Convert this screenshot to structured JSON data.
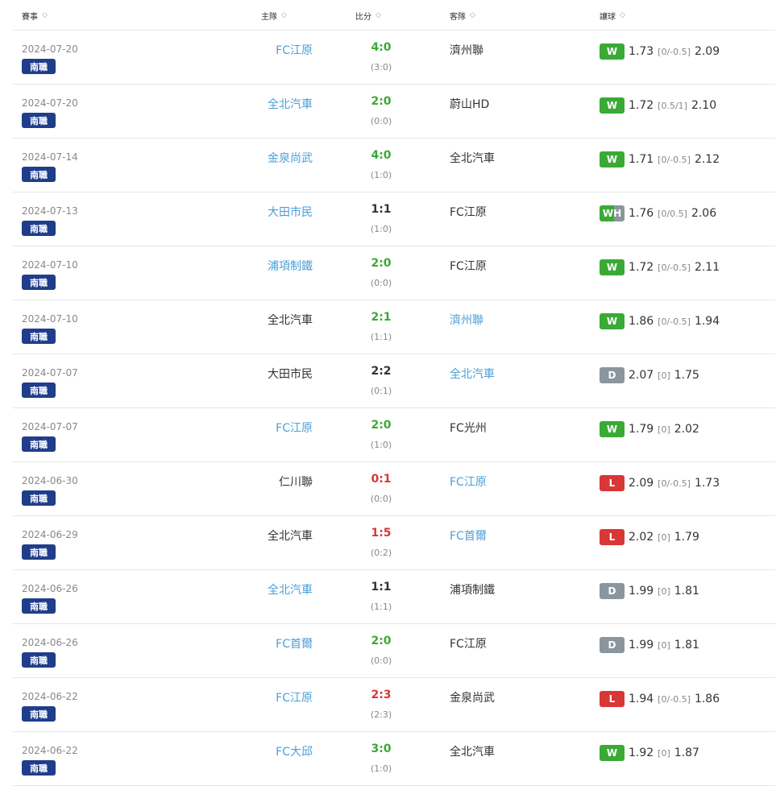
{
  "headers": {
    "league": "賽事",
    "home": "主隊",
    "score": "比分",
    "away": "客隊",
    "handicap": "讓球"
  },
  "colors": {
    "link": "#4a9fd8",
    "win": "#3aa935",
    "lose": "#d93636",
    "draw_badge": "#8b959e",
    "league_badge": "#1f3d8a"
  },
  "rows": [
    {
      "date": "2024-07-20",
      "league": "南職",
      "home": "FC江原",
      "home_link": true,
      "score": "4:0",
      "result": "win",
      "half": "(3:0)",
      "away": "濟州聯",
      "away_link": false,
      "badge": "W",
      "odds1": "1.73",
      "line": "[0/-0.5]",
      "odds2": "2.09"
    },
    {
      "date": "2024-07-20",
      "league": "南職",
      "home": "全北汽車",
      "home_link": true,
      "score": "2:0",
      "result": "win",
      "half": "(0:0)",
      "away": "蔚山HD",
      "away_link": false,
      "badge": "W",
      "odds1": "1.72",
      "line": "[0.5/1]",
      "odds2": "2.10"
    },
    {
      "date": "2024-07-14",
      "league": "南職",
      "home": "金泉尚武",
      "home_link": true,
      "score": "4:0",
      "result": "win",
      "half": "(1:0)",
      "away": "全北汽車",
      "away_link": false,
      "badge": "W",
      "odds1": "1.71",
      "line": "[0/-0.5]",
      "odds2": "2.12"
    },
    {
      "date": "2024-07-13",
      "league": "南職",
      "home": "大田市民",
      "home_link": true,
      "score": "1:1",
      "result": "draw",
      "half": "(1:0)",
      "away": "FC江原",
      "away_link": false,
      "badge": "WH",
      "odds1": "1.76",
      "line": "[0/0.5]",
      "odds2": "2.06"
    },
    {
      "date": "2024-07-10",
      "league": "南職",
      "home": "浦項制鐵",
      "home_link": true,
      "score": "2:0",
      "result": "win",
      "half": "(0:0)",
      "away": "FC江原",
      "away_link": false,
      "badge": "W",
      "odds1": "1.72",
      "line": "[0/-0.5]",
      "odds2": "2.11"
    },
    {
      "date": "2024-07-10",
      "league": "南職",
      "home": "全北汽車",
      "home_link": false,
      "score": "2:1",
      "result": "win",
      "half": "(1:1)",
      "away": "濟州聯",
      "away_link": true,
      "badge": "W",
      "odds1": "1.86",
      "line": "[0/-0.5]",
      "odds2": "1.94"
    },
    {
      "date": "2024-07-07",
      "league": "南職",
      "home": "大田市民",
      "home_link": false,
      "score": "2:2",
      "result": "draw",
      "half": "(0:1)",
      "away": "全北汽車",
      "away_link": true,
      "badge": "D",
      "odds1": "2.07",
      "line": "[0]",
      "odds2": "1.75"
    },
    {
      "date": "2024-07-07",
      "league": "南職",
      "home": "FC江原",
      "home_link": true,
      "score": "2:0",
      "result": "win",
      "half": "(1:0)",
      "away": "FC光州",
      "away_link": false,
      "badge": "W",
      "odds1": "1.79",
      "line": "[0]",
      "odds2": "2.02"
    },
    {
      "date": "2024-06-30",
      "league": "南職",
      "home": "仁川聯",
      "home_link": false,
      "score": "0:1",
      "result": "lose",
      "half": "(0:0)",
      "away": "FC江原",
      "away_link": true,
      "badge": "L",
      "odds1": "2.09",
      "line": "[0/-0.5]",
      "odds2": "1.73"
    },
    {
      "date": "2024-06-29",
      "league": "南職",
      "home": "全北汽車",
      "home_link": false,
      "score": "1:5",
      "result": "lose",
      "half": "(0:2)",
      "away": "FC首爾",
      "away_link": true,
      "badge": "L",
      "odds1": "2.02",
      "line": "[0]",
      "odds2": "1.79"
    },
    {
      "date": "2024-06-26",
      "league": "南職",
      "home": "全北汽車",
      "home_link": true,
      "score": "1:1",
      "result": "draw",
      "half": "(1:1)",
      "away": "浦項制鐵",
      "away_link": false,
      "badge": "D",
      "odds1": "1.99",
      "line": "[0]",
      "odds2": "1.81"
    },
    {
      "date": "2024-06-26",
      "league": "南職",
      "home": "FC首爾",
      "home_link": true,
      "score": "2:0",
      "result": "win",
      "half": "(0:0)",
      "away": "FC江原",
      "away_link": false,
      "badge": "D",
      "odds1": "1.99",
      "line": "[0]",
      "odds2": "1.81"
    },
    {
      "date": "2024-06-22",
      "league": "南職",
      "home": "FC江原",
      "home_link": true,
      "score": "2:3",
      "result": "lose",
      "half": "(2:3)",
      "away": "金泉尚武",
      "away_link": false,
      "badge": "L",
      "odds1": "1.94",
      "line": "[0/-0.5]",
      "odds2": "1.86"
    },
    {
      "date": "2024-06-22",
      "league": "南職",
      "home": "FC大邱",
      "home_link": true,
      "score": "3:0",
      "result": "win",
      "half": "(1:0)",
      "away": "全北汽車",
      "away_link": false,
      "badge": "W",
      "odds1": "1.92",
      "line": "[0]",
      "odds2": "1.87"
    }
  ]
}
